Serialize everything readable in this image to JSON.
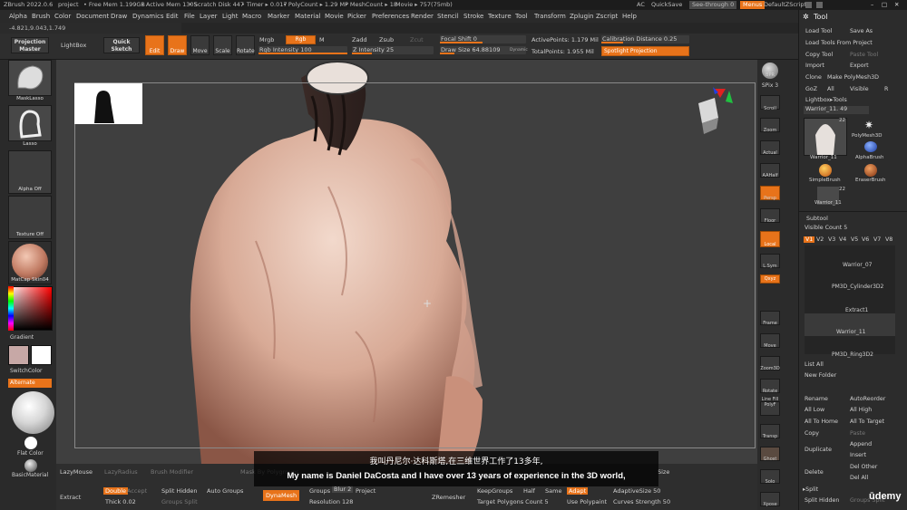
{
  "titlebar": {
    "app": "ZBrush 2022.0.6",
    "project": "project",
    "free_mem": "• Free Mem 1.199GB",
    "active_mem": "• Active Mem 1305",
    "scratch": "• Scratch Disk 447",
    "timer": "• Timer ▸ 0.017",
    "polycount": "• PolyCount ▸ 1.29 MP",
    "meshcount": "• MeshCount ▸ 18",
    "movie": "Movie ▸ 757(75mb)",
    "ac": "AC",
    "quicksave": "QuickSave",
    "seethrough": "See-through  0",
    "menus": "Menus",
    "default_script": "DefaultZScript"
  },
  "menu": [
    "Alpha",
    "Brush",
    "Color",
    "Document",
    "Draw",
    "Dynamics",
    "Edit",
    "File",
    "Layer",
    "Light",
    "Macro",
    "Marker",
    "Material",
    "Movie",
    "Picker",
    "Preferences",
    "Render",
    "Stencil",
    "Stroke",
    "Texture",
    "Tool",
    "Transform",
    "Zplugin",
    "Zscript",
    "Help"
  ],
  "coords": "-4.821,9.043,1.749",
  "toolbar": {
    "projection_master": "Projection Master",
    "lightbox": "LightBox",
    "quick_sketch": "Quick Sketch",
    "edit": "Edit",
    "draw": "Draw",
    "move": "Move",
    "scale": "Scale",
    "rotate": "Rotate",
    "mrgb": "Mrgb",
    "rgb": "Rgb",
    "m": "M",
    "rgb_intensity": "Rgb Intensity 100",
    "zadd": "Zadd",
    "zsub": "Zsub",
    "zcut": "Zcut",
    "z_intensity": "Z Intensity 25",
    "focal_shift": "Focal Shift 0",
    "draw_size": "Draw Size 64.88109",
    "dynamic": "Dynamic",
    "active_points": "ActivePoints: 1.179 Mil",
    "total_points": "TotalPoints: 1.955 Mil",
    "calibration": "Calibration Distance 0.25",
    "spotlight": "Spotlight Projection"
  },
  "left_shelf": {
    "mask_lasso": "MaskLasso",
    "lasso": "Lasso",
    "alpha_off": "Alpha Off",
    "texture_off": "Texture Off",
    "matcap": "MatCap Skin04",
    "gradient": "Gradient",
    "switch_color": "SwitchColor",
    "alternate": "Alternate",
    "flat_color": "Flat Color",
    "basic_material": "BasicMaterial"
  },
  "right_shelf": [
    "BPR",
    "SPix 3",
    "Scroll",
    "Zoom",
    "Actual",
    "AAHalf",
    "Persp",
    "Floor",
    "Local",
    "L.Sym",
    "Qxyz",
    "Frame",
    "Move",
    "Zoom3D",
    "Rotate",
    "Line Fill PolyF",
    "Transp",
    "Ghost",
    "Solo",
    "Xpose"
  ],
  "tool_panel": {
    "title": "Tool",
    "load_tool": "Load Tool",
    "save_as": "Save As",
    "load_from_project": "Load Tools From Project",
    "copy_tool": "Copy Tool",
    "paste_tool": "Paste Tool",
    "import": "Import",
    "export": "Export",
    "clone": "Clone",
    "make_polymesh": "Make PolyMesh3D",
    "goz": "GoZ",
    "all": "All",
    "visible": "Visible",
    "r": "R",
    "lightbox_tools": "Lightbox▸Tools",
    "current_tool": "Warrior_11. 49",
    "thumb_count": "22",
    "thumbs": [
      "Warrior_11",
      "PolyMesh3D",
      "AlphaBrush",
      "SimpleBrush",
      "EraserBrush",
      "Warrior_11"
    ],
    "subtool": "Subtool",
    "visible_count": "Visible Count 5",
    "versions": [
      "V1",
      "V2",
      "V3",
      "V4",
      "V5",
      "V6",
      "V7",
      "V8"
    ],
    "subtools": [
      "Warrior_07",
      "PM3D_Cylinder3D2",
      "Extract1",
      "Warrior_11",
      "PM3D_Ring3D2"
    ],
    "list_all": "List All",
    "new_folder": "New Folder",
    "rename": "Rename",
    "auto_reorder": "AutoReorder",
    "all_low": "All Low",
    "all_high": "All High",
    "all_to_home": "All To Home",
    "all_to_target": "All To Target",
    "copy": "Copy",
    "paste": "Paste",
    "append": "Append",
    "duplicate": "Duplicate",
    "insert": "Insert",
    "del_other": "Del Other",
    "delete": "Delete",
    "del_all": "Del All",
    "split": "▸Split",
    "split_hidden": "Split Hidden",
    "groups_split": "Groups Split"
  },
  "bottom": {
    "lazymouse": "LazyMouse",
    "lazyradius": "LazyRadius",
    "brush_modifier": "Brush Modifier",
    "mask_by_polygroups": "Mask By Polygroups",
    "size": "Size",
    "extract": "Extract",
    "double": "Double",
    "accept": "Accept",
    "thick": "Thick 0.02",
    "split_hidden": "Split Hidden",
    "auto_groups": "Auto Groups",
    "groups_split": "Groups Split",
    "dynamesh": "DynaMesh",
    "groups": "Groups",
    "blur": "Blur 2",
    "project": "Project",
    "resolution": "Resolution 128",
    "zremesher": "ZRemesher",
    "keep_groups": "KeepGroups",
    "half": "Half",
    "same": "Same",
    "adapt": "Adapt",
    "adaptive_size": "AdaptiveSize 50",
    "target_poly": "Target Polygons Count 5",
    "use_polypaint": "Use Polypaint",
    "curves_strength": "Curves Strength 50"
  },
  "subtitle": {
    "cn": "我叫丹尼尔·达科斯塔,在三维世界工作了13多年,",
    "en": "My name is Daniel DaCosta and I have over 13 years of experience in the 3D world,"
  },
  "watermark": "ūdemy",
  "colors": {
    "accent": "#e8731a",
    "panel": "#2c2c2c",
    "canvas": "#3f3f3f"
  }
}
